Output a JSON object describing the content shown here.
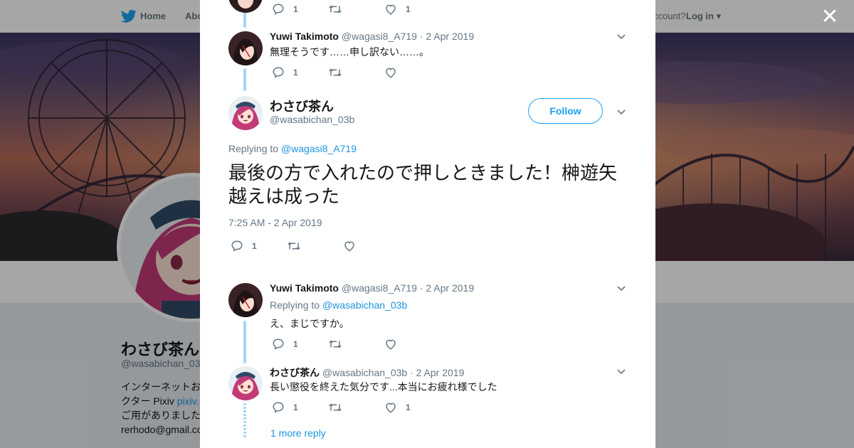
{
  "nav": {
    "home_label": "Home",
    "about_label": "Abo",
    "account_label": "ccount?",
    "login_label": "Log in"
  },
  "profile": {
    "name": "わさび茶ん",
    "handle": "@wasabichan_03",
    "bio_lines": [
      "インターネットお",
      "クター Pixiv ",
      "ご用がありました",
      "rerhodo@gmail.co"
    ],
    "bio_link": "pixiv."
  },
  "modal": {
    "close_icon": "close-icon",
    "tweets_above": [
      {
        "actions": {
          "reply_count": "1",
          "retweet_count": "",
          "like_count": "1"
        }
      },
      {
        "name": "Yuwi Takimoto",
        "handle": "@wagasi8_A719",
        "date": "2 Apr 2019",
        "text": "無理そうです……申し訳ない……。",
        "actions": {
          "reply_count": "1",
          "retweet_count": "",
          "like_count": ""
        }
      }
    ],
    "main_tweet": {
      "name": "わさび茶ん",
      "handle": "@wasabichan_03b",
      "follow_label": "Follow",
      "replying_to_label": "Replying to ",
      "replying_to": "@wagasi8_A719",
      "text": "最後の方で入れたので押しときました！榊遊矢越えは成った",
      "time": "7:25 AM - 2 Apr 2019",
      "actions": {
        "reply_count": "1",
        "retweet_count": "",
        "like_count": ""
      }
    },
    "replies": [
      {
        "name": "Yuwi Takimoto",
        "handle": "@wagasi8_A719",
        "date": "2 Apr 2019",
        "replying_to_label": "Replying to ",
        "replying_to": "@wasabichan_03b",
        "text": "え、まじですか。",
        "actions": {
          "reply_count": "1",
          "retweet_count": "",
          "like_count": ""
        }
      },
      {
        "name": "わさび茶ん",
        "handle": "@wasabichan_03b",
        "date": "2 Apr 2019",
        "text": "長い懲役を終えた気分です...本当にお疲れ様でした",
        "actions": {
          "reply_count": "1",
          "retweet_count": "",
          "like_count": "1"
        }
      }
    ],
    "more_replies_label": "1 more reply"
  },
  "colors": {
    "accent": "#1da1f2",
    "link": "#1b95e0",
    "muted": "#657786",
    "thread_line": "#a3d6f8"
  }
}
